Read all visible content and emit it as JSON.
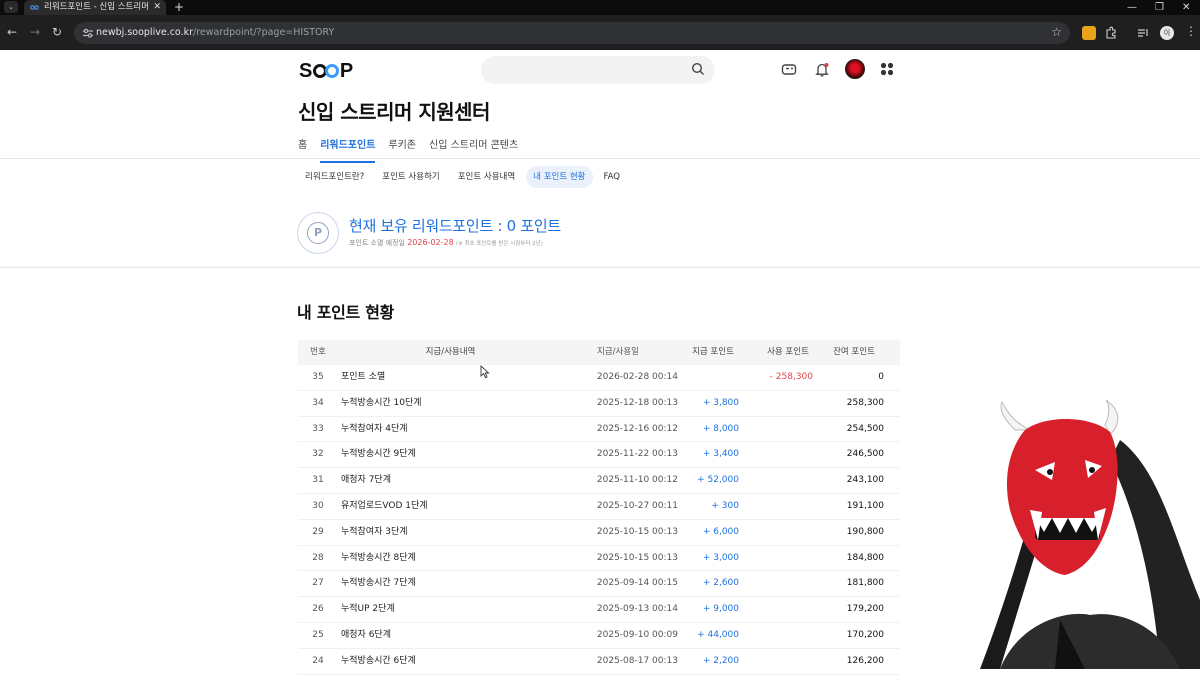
{
  "browser": {
    "tab_title": "리워드포인트 - 신입 스트리머",
    "tab_close": "✕",
    "new_tab": "+",
    "url_host": "newbj.sooplive.co.kr",
    "url_path": "/rewardpoint/?page=HISTORY",
    "profile_initial": "이"
  },
  "header": {
    "logo_prefix": "S",
    "logo_suffix": "P",
    "search": {
      "placeholder": ""
    }
  },
  "page_title": "신입 스트리머 지원센터",
  "main_tabs": [
    {
      "label": "홈",
      "active": false
    },
    {
      "label": "리워드포인트",
      "active": true
    },
    {
      "label": "루키존",
      "active": false
    },
    {
      "label": "신입 스트리머 콘텐츠",
      "active": false
    }
  ],
  "sub_tabs": [
    {
      "label": "리워드포인트란?",
      "active": false
    },
    {
      "label": "포인트 사용하기",
      "active": false
    },
    {
      "label": "포인트 사용내역",
      "active": false
    },
    {
      "label": "내 포인트 현황",
      "active": true
    },
    {
      "label": "FAQ",
      "active": false
    }
  ],
  "points": {
    "badge": "P",
    "summary": "현재 보유 리워드포인트 : 0 포인트",
    "expiry_label": "포인트 소멸 예정일",
    "expiry_date": "2026-02-28",
    "expiry_note": "(※ 최초 포인트를 받은 시점부터 2년)"
  },
  "section_title": "내 포인트 현황",
  "table": {
    "headers": {
      "no": "번호",
      "desc": "지급/사용내역",
      "date": "지급/사용일",
      "give": "지급 포인트",
      "use": "사용 포인트",
      "balance": "잔여 포인트"
    },
    "rows": [
      {
        "no": "35",
        "desc": "포인트 소멸",
        "date": "2026-02-28 00:14",
        "give": "",
        "use": "- 258,300",
        "balance": "0"
      },
      {
        "no": "34",
        "desc": "누적방송시간 10단계",
        "date": "2025-12-18 00:13",
        "give": "+ 3,800",
        "use": "",
        "balance": "258,300"
      },
      {
        "no": "33",
        "desc": "누적참여자 4단계",
        "date": "2025-12-16 00:12",
        "give": "+ 8,000",
        "use": "",
        "balance": "254,500"
      },
      {
        "no": "32",
        "desc": "누적방송시간 9단계",
        "date": "2025-11-22 00:13",
        "give": "+ 3,400",
        "use": "",
        "balance": "246,500"
      },
      {
        "no": "31",
        "desc": "애청자 7단계",
        "date": "2025-11-10 00:12",
        "give": "+ 52,000",
        "use": "",
        "balance": "243,100"
      },
      {
        "no": "30",
        "desc": "유저업로드VOD 1단계",
        "date": "2025-10-27 00:11",
        "give": "+ 300",
        "use": "",
        "balance": "191,100"
      },
      {
        "no": "29",
        "desc": "누적참여자 3단계",
        "date": "2025-10-15 00:13",
        "give": "+ 6,000",
        "use": "",
        "balance": "190,800"
      },
      {
        "no": "28",
        "desc": "누적방송시간 8단계",
        "date": "2025-10-15 00:13",
        "give": "+ 3,000",
        "use": "",
        "balance": "184,800"
      },
      {
        "no": "27",
        "desc": "누적방송시간 7단계",
        "date": "2025-09-14 00:15",
        "give": "+ 2,600",
        "use": "",
        "balance": "181,800"
      },
      {
        "no": "26",
        "desc": "누적UP 2단계",
        "date": "2025-09-13 00:14",
        "give": "+ 9,000",
        "use": "",
        "balance": "179,200"
      },
      {
        "no": "25",
        "desc": "애청자 6단계",
        "date": "2025-09-10 00:09",
        "give": "+ 44,000",
        "use": "",
        "balance": "170,200"
      },
      {
        "no": "24",
        "desc": "누적방송시간 6단계",
        "date": "2025-08-17 00:13",
        "give": "+ 2,200",
        "use": "",
        "balance": "126,200"
      }
    ]
  },
  "colors": {
    "accent": "#1e72e0",
    "negative": "#e0444b"
  },
  "icons": [
    "search-icon",
    "broadcast-icon",
    "bell-icon",
    "apps-icon",
    "p-coin-icon",
    "star-icon"
  ]
}
